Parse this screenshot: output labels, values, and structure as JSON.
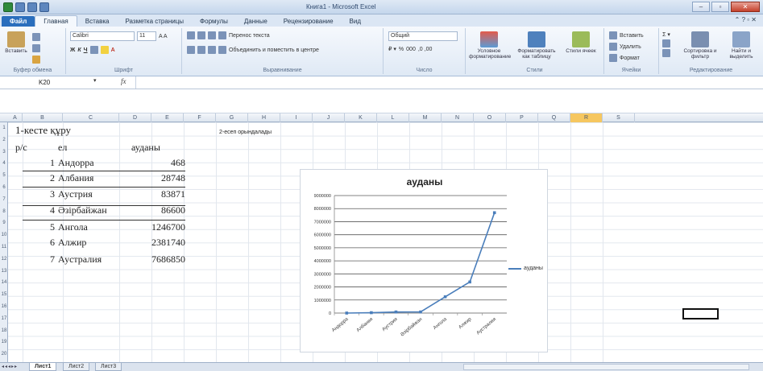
{
  "window": {
    "title": "Книга1 - Microsoft Excel"
  },
  "ribbon": {
    "tabs": [
      "Файл",
      "Главная",
      "Вставка",
      "Разметка страницы",
      "Формулы",
      "Данные",
      "Рецензирование",
      "Вид"
    ],
    "active_tab": "Главная",
    "groups": {
      "clipboard": {
        "label": "Буфер обмена",
        "paste": "Вставить"
      },
      "font": {
        "label": "Шрифт",
        "font_name": "Calibri",
        "font_size": "11"
      },
      "alignment": {
        "label": "Выравнивание",
        "wrap": "Перенос текста",
        "merge": "Объединить и поместить в центре"
      },
      "number": {
        "label": "Число",
        "format": "Общий"
      },
      "styles": {
        "label": "Стили",
        "cond": "Условное форматирование",
        "as_table": "Форматировать как таблицу",
        "cell_styles": "Стили ячеек"
      },
      "cells": {
        "label": "Ячейки",
        "insert": "Вставить",
        "delete": "Удалить",
        "format": "Формат"
      },
      "editing": {
        "label": "Редактирование",
        "sort": "Сортировка и фильтр",
        "find": "Найти и выделить"
      }
    }
  },
  "formula_bar": {
    "name_box": "K20",
    "fx": "fx",
    "value": ""
  },
  "columns": [
    "A",
    "B",
    "C",
    "D",
    "E",
    "F",
    "G",
    "H",
    "I",
    "J",
    "K",
    "L",
    "M",
    "N",
    "O",
    "P",
    "Q",
    "R",
    "S"
  ],
  "selected_column": "R",
  "rows": [
    "1",
    "2",
    "3",
    "4",
    "5",
    "6",
    "7",
    "8",
    "9",
    "10",
    "11",
    "12",
    "13",
    "14",
    "15",
    "16",
    "17",
    "18",
    "19",
    "20"
  ],
  "sheet": {
    "title": "1-кесте құру",
    "note": "2-есеп орындалады",
    "headers": {
      "no": "p/c",
      "name": "ел",
      "area": "ауданы"
    },
    "table": [
      {
        "no": "1",
        "name": "Андорра",
        "area": "468"
      },
      {
        "no": "2",
        "name": "Албания",
        "area": "28748"
      },
      {
        "no": "3",
        "name": "Аустрия",
        "area": "83871"
      },
      {
        "no": "4",
        "name": "Әзірбайжан",
        "area": "86600"
      },
      {
        "no": "5",
        "name": "Ангола",
        "area": "1246700"
      },
      {
        "no": "6",
        "name": "Алжир",
        "area": "2381740"
      },
      {
        "no": "7",
        "name": "Аустралия",
        "area": "7686850"
      }
    ]
  },
  "chart_data": {
    "type": "line",
    "title": "ауданы",
    "categories": [
      "Андорра",
      "Албания",
      "Аустрия",
      "Әзірбайжан",
      "Ангола",
      "Алжир",
      "Аустралия"
    ],
    "series": [
      {
        "name": "ауданы",
        "values": [
          468,
          28748,
          83871,
          86600,
          1246700,
          2381740,
          7686850
        ]
      }
    ],
    "y_ticks": [
      "0",
      "1000000",
      "2000000",
      "3000000",
      "4000000",
      "5000000",
      "6000000",
      "7000000",
      "8000000",
      "9000000"
    ],
    "ylim": [
      0,
      9000000
    ],
    "grid": true,
    "legend": "right",
    "color": "#4a7ebb"
  },
  "sheet_tabs": [
    "Лист1",
    "Лист2",
    "Лист3"
  ],
  "active_sheet": "Лист1"
}
